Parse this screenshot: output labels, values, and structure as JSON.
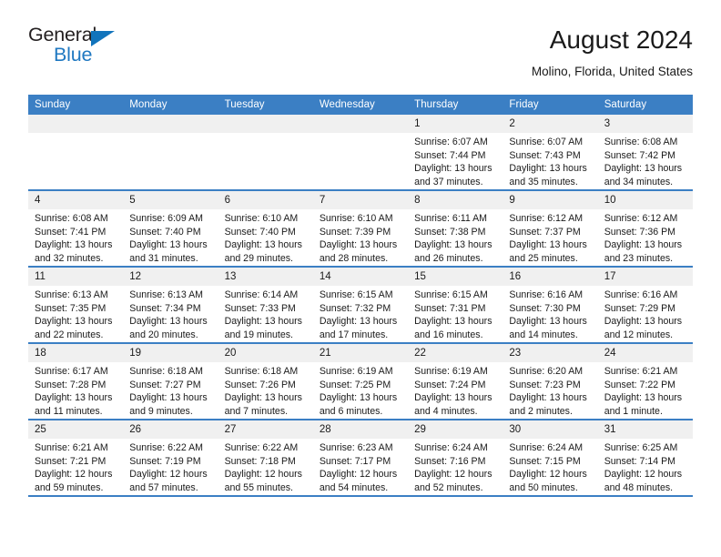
{
  "brand": {
    "name_part1": "General",
    "name_part2": "Blue",
    "triangle_icon": "triangle-icon",
    "colors": {
      "dark": "#231f20",
      "blue": "#1f78c1",
      "triangle": "#1274bc"
    }
  },
  "header": {
    "title": "August 2024",
    "location": "Molino, Florida, United States"
  },
  "theme": {
    "header_blue": "#3b7fc4",
    "daynum_band": "#f0f0f0",
    "text": "#1a1a1a"
  },
  "weekday_headers": [
    "Sunday",
    "Monday",
    "Tuesday",
    "Wednesday",
    "Thursday",
    "Friday",
    "Saturday"
  ],
  "weeks": [
    [
      {
        "day": "",
        "empty": true
      },
      {
        "day": "",
        "empty": true
      },
      {
        "day": "",
        "empty": true
      },
      {
        "day": "",
        "empty": true
      },
      {
        "day": "1",
        "sunrise": "Sunrise: 6:07 AM",
        "sunset": "Sunset: 7:44 PM",
        "daylight": "Daylight: 13 hours and 37 minutes."
      },
      {
        "day": "2",
        "sunrise": "Sunrise: 6:07 AM",
        "sunset": "Sunset: 7:43 PM",
        "daylight": "Daylight: 13 hours and 35 minutes."
      },
      {
        "day": "3",
        "sunrise": "Sunrise: 6:08 AM",
        "sunset": "Sunset: 7:42 PM",
        "daylight": "Daylight: 13 hours and 34 minutes."
      }
    ],
    [
      {
        "day": "4",
        "sunrise": "Sunrise: 6:08 AM",
        "sunset": "Sunset: 7:41 PM",
        "daylight": "Daylight: 13 hours and 32 minutes."
      },
      {
        "day": "5",
        "sunrise": "Sunrise: 6:09 AM",
        "sunset": "Sunset: 7:40 PM",
        "daylight": "Daylight: 13 hours and 31 minutes."
      },
      {
        "day": "6",
        "sunrise": "Sunrise: 6:10 AM",
        "sunset": "Sunset: 7:40 PM",
        "daylight": "Daylight: 13 hours and 29 minutes."
      },
      {
        "day": "7",
        "sunrise": "Sunrise: 6:10 AM",
        "sunset": "Sunset: 7:39 PM",
        "daylight": "Daylight: 13 hours and 28 minutes."
      },
      {
        "day": "8",
        "sunrise": "Sunrise: 6:11 AM",
        "sunset": "Sunset: 7:38 PM",
        "daylight": "Daylight: 13 hours and 26 minutes."
      },
      {
        "day": "9",
        "sunrise": "Sunrise: 6:12 AM",
        "sunset": "Sunset: 7:37 PM",
        "daylight": "Daylight: 13 hours and 25 minutes."
      },
      {
        "day": "10",
        "sunrise": "Sunrise: 6:12 AM",
        "sunset": "Sunset: 7:36 PM",
        "daylight": "Daylight: 13 hours and 23 minutes."
      }
    ],
    [
      {
        "day": "11",
        "sunrise": "Sunrise: 6:13 AM",
        "sunset": "Sunset: 7:35 PM",
        "daylight": "Daylight: 13 hours and 22 minutes."
      },
      {
        "day": "12",
        "sunrise": "Sunrise: 6:13 AM",
        "sunset": "Sunset: 7:34 PM",
        "daylight": "Daylight: 13 hours and 20 minutes."
      },
      {
        "day": "13",
        "sunrise": "Sunrise: 6:14 AM",
        "sunset": "Sunset: 7:33 PM",
        "daylight": "Daylight: 13 hours and 19 minutes."
      },
      {
        "day": "14",
        "sunrise": "Sunrise: 6:15 AM",
        "sunset": "Sunset: 7:32 PM",
        "daylight": "Daylight: 13 hours and 17 minutes."
      },
      {
        "day": "15",
        "sunrise": "Sunrise: 6:15 AM",
        "sunset": "Sunset: 7:31 PM",
        "daylight": "Daylight: 13 hours and 16 minutes."
      },
      {
        "day": "16",
        "sunrise": "Sunrise: 6:16 AM",
        "sunset": "Sunset: 7:30 PM",
        "daylight": "Daylight: 13 hours and 14 minutes."
      },
      {
        "day": "17",
        "sunrise": "Sunrise: 6:16 AM",
        "sunset": "Sunset: 7:29 PM",
        "daylight": "Daylight: 13 hours and 12 minutes."
      }
    ],
    [
      {
        "day": "18",
        "sunrise": "Sunrise: 6:17 AM",
        "sunset": "Sunset: 7:28 PM",
        "daylight": "Daylight: 13 hours and 11 minutes."
      },
      {
        "day": "19",
        "sunrise": "Sunrise: 6:18 AM",
        "sunset": "Sunset: 7:27 PM",
        "daylight": "Daylight: 13 hours and 9 minutes."
      },
      {
        "day": "20",
        "sunrise": "Sunrise: 6:18 AM",
        "sunset": "Sunset: 7:26 PM",
        "daylight": "Daylight: 13 hours and 7 minutes."
      },
      {
        "day": "21",
        "sunrise": "Sunrise: 6:19 AM",
        "sunset": "Sunset: 7:25 PM",
        "daylight": "Daylight: 13 hours and 6 minutes."
      },
      {
        "day": "22",
        "sunrise": "Sunrise: 6:19 AM",
        "sunset": "Sunset: 7:24 PM",
        "daylight": "Daylight: 13 hours and 4 minutes."
      },
      {
        "day": "23",
        "sunrise": "Sunrise: 6:20 AM",
        "sunset": "Sunset: 7:23 PM",
        "daylight": "Daylight: 13 hours and 2 minutes."
      },
      {
        "day": "24",
        "sunrise": "Sunrise: 6:21 AM",
        "sunset": "Sunset: 7:22 PM",
        "daylight": "Daylight: 13 hours and 1 minute."
      }
    ],
    [
      {
        "day": "25",
        "sunrise": "Sunrise: 6:21 AM",
        "sunset": "Sunset: 7:21 PM",
        "daylight": "Daylight: 12 hours and 59 minutes."
      },
      {
        "day": "26",
        "sunrise": "Sunrise: 6:22 AM",
        "sunset": "Sunset: 7:19 PM",
        "daylight": "Daylight: 12 hours and 57 minutes."
      },
      {
        "day": "27",
        "sunrise": "Sunrise: 6:22 AM",
        "sunset": "Sunset: 7:18 PM",
        "daylight": "Daylight: 12 hours and 55 minutes."
      },
      {
        "day": "28",
        "sunrise": "Sunrise: 6:23 AM",
        "sunset": "Sunset: 7:17 PM",
        "daylight": "Daylight: 12 hours and 54 minutes."
      },
      {
        "day": "29",
        "sunrise": "Sunrise: 6:24 AM",
        "sunset": "Sunset: 7:16 PM",
        "daylight": "Daylight: 12 hours and 52 minutes."
      },
      {
        "day": "30",
        "sunrise": "Sunrise: 6:24 AM",
        "sunset": "Sunset: 7:15 PM",
        "daylight": "Daylight: 12 hours and 50 minutes."
      },
      {
        "day": "31",
        "sunrise": "Sunrise: 6:25 AM",
        "sunset": "Sunset: 7:14 PM",
        "daylight": "Daylight: 12 hours and 48 minutes."
      }
    ]
  ]
}
